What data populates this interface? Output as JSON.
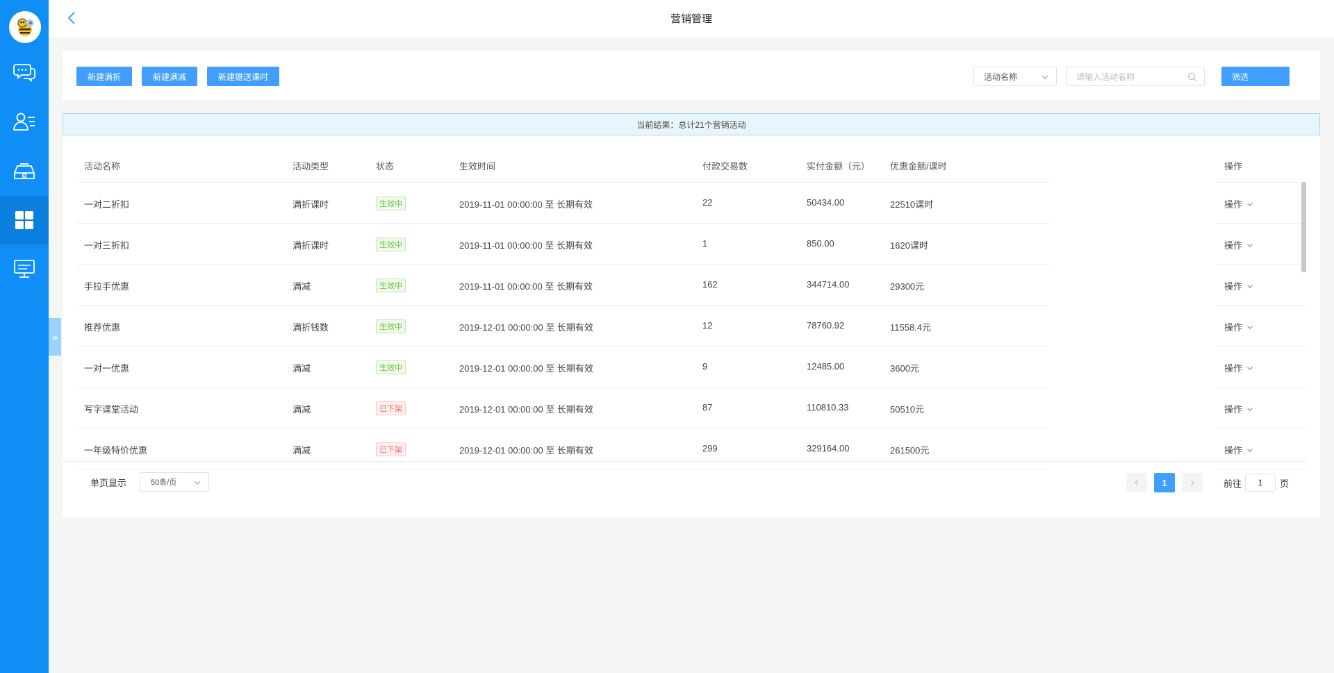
{
  "header": {
    "title": "营销管理"
  },
  "sidebar": {
    "items": [
      {
        "icon": "chat-icon"
      },
      {
        "icon": "user-list-icon"
      },
      {
        "icon": "device-icon"
      },
      {
        "icon": "grid-icon",
        "active": true
      },
      {
        "icon": "monitor-icon"
      }
    ]
  },
  "toolbar": {
    "btn_discount": "新建满折",
    "btn_reduce": "新建满减",
    "btn_gift": "新建赠送课时",
    "filter_field": "活动名称",
    "search_placeholder": "请输入活动名称",
    "filter_button": "筛选"
  },
  "result": {
    "text": "当前结果：总计21个营销活动"
  },
  "table": {
    "columns": {
      "name": "活动名称",
      "type": "活动类型",
      "status": "状态",
      "time": "生效时间",
      "count": "付款交易数",
      "amount": "实付金额（元）",
      "discount": "优惠金额/课时",
      "op": "操作"
    },
    "rows": [
      {
        "name": "一对二折扣",
        "type": "满折课时",
        "status": "生效中",
        "time": "2019-11-01 00:00:00 至 长期有效",
        "count": "22",
        "amount": "50434.00",
        "discount": "22510课时",
        "op": "操作"
      },
      {
        "name": "一对三折扣",
        "type": "满折课时",
        "status": "生效中",
        "time": "2019-11-01 00:00:00 至 长期有效",
        "count": "1",
        "amount": "850.00",
        "discount": "1620课时",
        "op": "操作"
      },
      {
        "name": "手拉手优惠",
        "type": "满减",
        "status": "生效中",
        "time": "2019-11-01 00:00:00 至 长期有效",
        "count": "162",
        "amount": "344714.00",
        "discount": "29300元",
        "op": "操作"
      },
      {
        "name": "推荐优惠",
        "type": "满折钱数",
        "status": "生效中",
        "time": "2019-12-01 00:00:00 至 长期有效",
        "count": "12",
        "amount": "78760.92",
        "discount": "11558.4元",
        "op": "操作"
      },
      {
        "name": "一对一优惠",
        "type": "满减",
        "status": "生效中",
        "time": "2019-12-01 00:00:00 至 长期有效",
        "count": "9",
        "amount": "12485.00",
        "discount": "3600元",
        "op": "操作"
      },
      {
        "name": "写字课堂活动",
        "type": "满减",
        "status": "已下架",
        "time": "2019-12-01 00:00:00 至 长期有效",
        "count": "87",
        "amount": "110810.33",
        "discount": "50510元",
        "op": "操作"
      },
      {
        "name": "一年级特价优惠",
        "type": "满减",
        "status": "已下架",
        "time": "2019-12-01 00:00:00 至 长期有效",
        "count": "299",
        "amount": "329164.00",
        "discount": "261500元",
        "op": "操作"
      }
    ]
  },
  "pagination": {
    "page_size_label": "单页显示",
    "page_size": "50条/页",
    "current_page": "1",
    "goto_label": "前往",
    "goto_value": "1",
    "page_unit": "页"
  },
  "colors": {
    "sidebar": "#0f8ff5",
    "primary": "#409eff",
    "active_tag": "#67c23a",
    "off_tag": "#f56c6c"
  }
}
